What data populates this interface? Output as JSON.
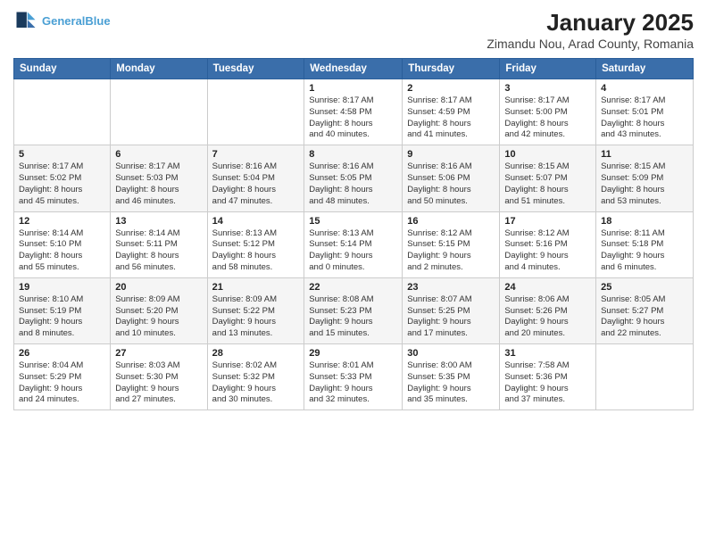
{
  "header": {
    "logo_line1": "General",
    "logo_line2": "Blue",
    "main_title": "January 2025",
    "subtitle": "Zimandu Nou, Arad County, Romania"
  },
  "days_of_week": [
    "Sunday",
    "Monday",
    "Tuesday",
    "Wednesday",
    "Thursday",
    "Friday",
    "Saturday"
  ],
  "weeks": [
    [
      {
        "day": "",
        "info": ""
      },
      {
        "day": "",
        "info": ""
      },
      {
        "day": "",
        "info": ""
      },
      {
        "day": "1",
        "info": "Sunrise: 8:17 AM\nSunset: 4:58 PM\nDaylight: 8 hours\nand 40 minutes."
      },
      {
        "day": "2",
        "info": "Sunrise: 8:17 AM\nSunset: 4:59 PM\nDaylight: 8 hours\nand 41 minutes."
      },
      {
        "day": "3",
        "info": "Sunrise: 8:17 AM\nSunset: 5:00 PM\nDaylight: 8 hours\nand 42 minutes."
      },
      {
        "day": "4",
        "info": "Sunrise: 8:17 AM\nSunset: 5:01 PM\nDaylight: 8 hours\nand 43 minutes."
      }
    ],
    [
      {
        "day": "5",
        "info": "Sunrise: 8:17 AM\nSunset: 5:02 PM\nDaylight: 8 hours\nand 45 minutes."
      },
      {
        "day": "6",
        "info": "Sunrise: 8:17 AM\nSunset: 5:03 PM\nDaylight: 8 hours\nand 46 minutes."
      },
      {
        "day": "7",
        "info": "Sunrise: 8:16 AM\nSunset: 5:04 PM\nDaylight: 8 hours\nand 47 minutes."
      },
      {
        "day": "8",
        "info": "Sunrise: 8:16 AM\nSunset: 5:05 PM\nDaylight: 8 hours\nand 48 minutes."
      },
      {
        "day": "9",
        "info": "Sunrise: 8:16 AM\nSunset: 5:06 PM\nDaylight: 8 hours\nand 50 minutes."
      },
      {
        "day": "10",
        "info": "Sunrise: 8:15 AM\nSunset: 5:07 PM\nDaylight: 8 hours\nand 51 minutes."
      },
      {
        "day": "11",
        "info": "Sunrise: 8:15 AM\nSunset: 5:09 PM\nDaylight: 8 hours\nand 53 minutes."
      }
    ],
    [
      {
        "day": "12",
        "info": "Sunrise: 8:14 AM\nSunset: 5:10 PM\nDaylight: 8 hours\nand 55 minutes."
      },
      {
        "day": "13",
        "info": "Sunrise: 8:14 AM\nSunset: 5:11 PM\nDaylight: 8 hours\nand 56 minutes."
      },
      {
        "day": "14",
        "info": "Sunrise: 8:13 AM\nSunset: 5:12 PM\nDaylight: 8 hours\nand 58 minutes."
      },
      {
        "day": "15",
        "info": "Sunrise: 8:13 AM\nSunset: 5:14 PM\nDaylight: 9 hours\nand 0 minutes."
      },
      {
        "day": "16",
        "info": "Sunrise: 8:12 AM\nSunset: 5:15 PM\nDaylight: 9 hours\nand 2 minutes."
      },
      {
        "day": "17",
        "info": "Sunrise: 8:12 AM\nSunset: 5:16 PM\nDaylight: 9 hours\nand 4 minutes."
      },
      {
        "day": "18",
        "info": "Sunrise: 8:11 AM\nSunset: 5:18 PM\nDaylight: 9 hours\nand 6 minutes."
      }
    ],
    [
      {
        "day": "19",
        "info": "Sunrise: 8:10 AM\nSunset: 5:19 PM\nDaylight: 9 hours\nand 8 minutes."
      },
      {
        "day": "20",
        "info": "Sunrise: 8:09 AM\nSunset: 5:20 PM\nDaylight: 9 hours\nand 10 minutes."
      },
      {
        "day": "21",
        "info": "Sunrise: 8:09 AM\nSunset: 5:22 PM\nDaylight: 9 hours\nand 13 minutes."
      },
      {
        "day": "22",
        "info": "Sunrise: 8:08 AM\nSunset: 5:23 PM\nDaylight: 9 hours\nand 15 minutes."
      },
      {
        "day": "23",
        "info": "Sunrise: 8:07 AM\nSunset: 5:25 PM\nDaylight: 9 hours\nand 17 minutes."
      },
      {
        "day": "24",
        "info": "Sunrise: 8:06 AM\nSunset: 5:26 PM\nDaylight: 9 hours\nand 20 minutes."
      },
      {
        "day": "25",
        "info": "Sunrise: 8:05 AM\nSunset: 5:27 PM\nDaylight: 9 hours\nand 22 minutes."
      }
    ],
    [
      {
        "day": "26",
        "info": "Sunrise: 8:04 AM\nSunset: 5:29 PM\nDaylight: 9 hours\nand 24 minutes."
      },
      {
        "day": "27",
        "info": "Sunrise: 8:03 AM\nSunset: 5:30 PM\nDaylight: 9 hours\nand 27 minutes."
      },
      {
        "day": "28",
        "info": "Sunrise: 8:02 AM\nSunset: 5:32 PM\nDaylight: 9 hours\nand 30 minutes."
      },
      {
        "day": "29",
        "info": "Sunrise: 8:01 AM\nSunset: 5:33 PM\nDaylight: 9 hours\nand 32 minutes."
      },
      {
        "day": "30",
        "info": "Sunrise: 8:00 AM\nSunset: 5:35 PM\nDaylight: 9 hours\nand 35 minutes."
      },
      {
        "day": "31",
        "info": "Sunrise: 7:58 AM\nSunset: 5:36 PM\nDaylight: 9 hours\nand 37 minutes."
      },
      {
        "day": "",
        "info": ""
      }
    ]
  ]
}
